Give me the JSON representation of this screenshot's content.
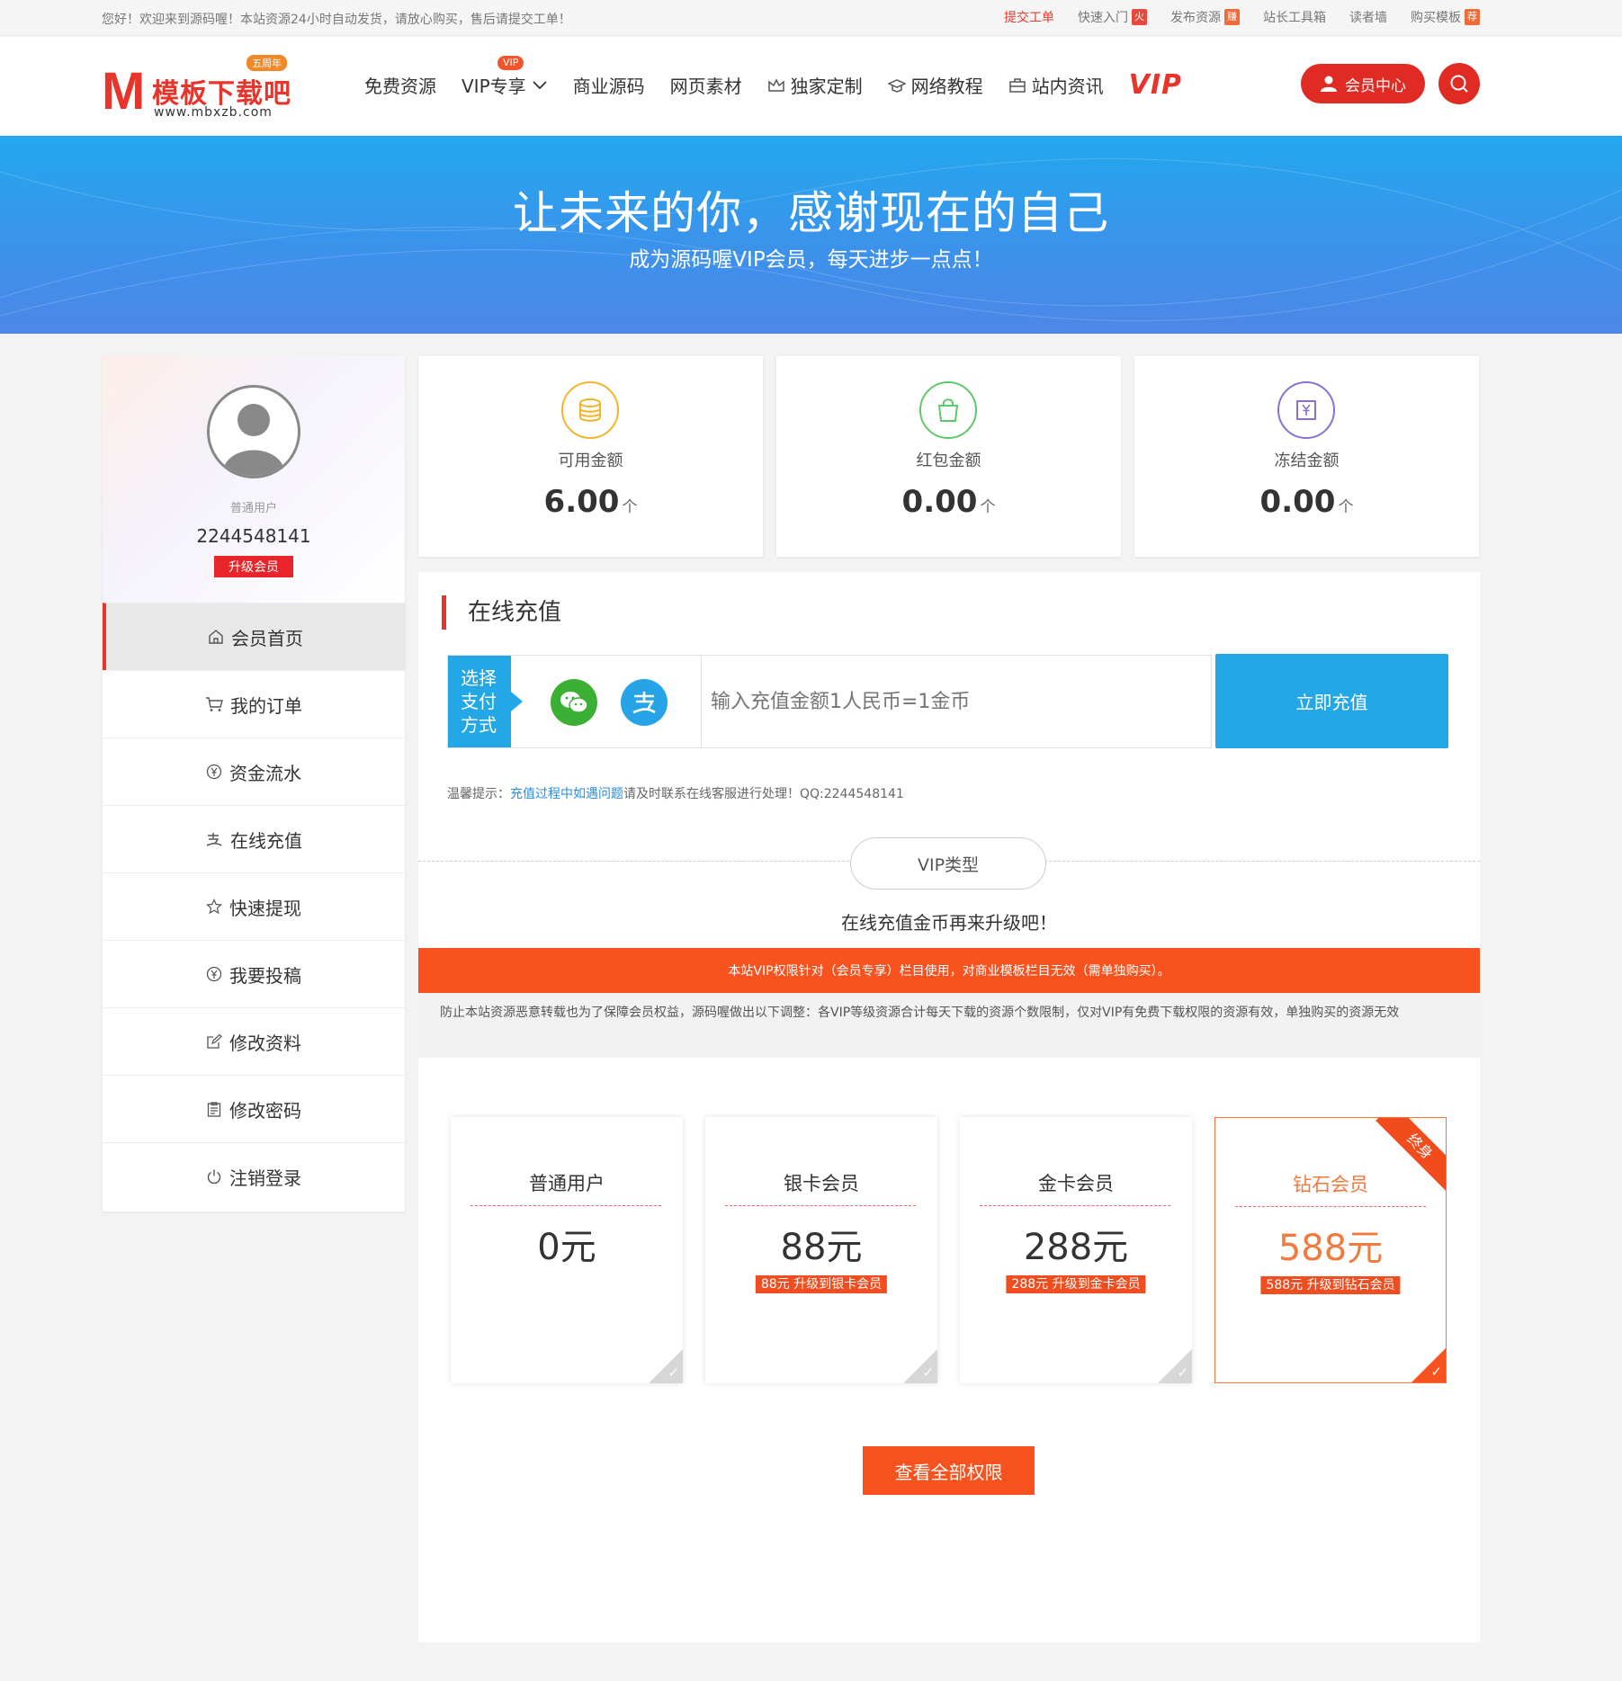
{
  "topbar": {
    "welcome": "您好！欢迎来到源码喔！本站资源24小时自动发货，请放心购买，售后请提交工单！",
    "links": [
      {
        "label": "提交工单",
        "tag": ""
      },
      {
        "label": "快速入门",
        "tag": "火"
      },
      {
        "label": "发布资源",
        "tag": "赚"
      },
      {
        "label": "站长工具箱",
        "tag": ""
      },
      {
        "label": "读者墙",
        "tag": ""
      },
      {
        "label": "购买模板",
        "tag": "荐"
      }
    ]
  },
  "header": {
    "logo": {
      "mark": "M",
      "name": "模板下载吧",
      "url": "www.mbxzb.com",
      "badge": "五周年"
    },
    "nav": [
      "免费资源",
      "VIP专享",
      "商业源码",
      "网页素材",
      "独家定制",
      "网络教程",
      "站内资讯"
    ],
    "vip_badge": "VIP",
    "vip_word": "VIP",
    "member_center": "会员中心"
  },
  "banner": {
    "title": "让未来的你，感谢现在的自己",
    "subtitle": "成为源码喔VIP会员，每天进步一点点！"
  },
  "profile": {
    "role": "普通用户",
    "uid": "2244548141",
    "upgrade": "升级会员"
  },
  "menu": [
    "会员首页",
    "我的订单",
    "资金流水",
    "在线充值",
    "快速提现",
    "我要投稿",
    "修改资料",
    "修改密码",
    "注销登录"
  ],
  "stats": [
    {
      "label": "可用金额",
      "value": "6.00",
      "unit": "个",
      "color": "#f5b42a"
    },
    {
      "label": "红包金额",
      "value": "0.00",
      "unit": "个",
      "color": "#5cc96b"
    },
    {
      "label": "冻结金额",
      "value": "0.00",
      "unit": "个",
      "color": "#8a6fd6"
    }
  ],
  "recharge": {
    "title": "在线充值",
    "select_label": "选择支付方式",
    "placeholder": "输入充值金额1人民币=1金币",
    "pay_button": "立即充值",
    "tip_prefix": "温馨提示：",
    "tip_link": "充值过程中如遇问题",
    "tip_suffix": "请及时联系在线客服进行处理！QQ:2244548141"
  },
  "vip": {
    "type_label": "VIP类型",
    "hint": "在线充值金币再来升级吧！",
    "notice": "本站VIP权限针对（会员专享）栏目使用，对商业模板栏目无效（需单独购买）。",
    "note": "防止本站资源恶意转载也为了保障会员权益，源码喔做出以下调整：各VIP等级资源合计每天下载的资源个数限制，仅对VIP有免费下载权限的资源有效，单独购买的资源无效",
    "cards": [
      {
        "name": "普通用户",
        "price": "0元",
        "tag": ""
      },
      {
        "name": "银卡会员",
        "price": "88元",
        "tag": "88元 升级到银卡会员"
      },
      {
        "name": "金卡会员",
        "price": "288元",
        "tag": "288元 升级到金卡会员"
      },
      {
        "name": "钻石会员",
        "price": "588元",
        "tag": "588元 升级到钻石会员",
        "ribbon": "终身"
      }
    ],
    "view_all": "查看全部权限"
  },
  "colors": {
    "brand_red": "#e8352c",
    "blue": "#23a7e6",
    "orange": "#f8531f"
  }
}
